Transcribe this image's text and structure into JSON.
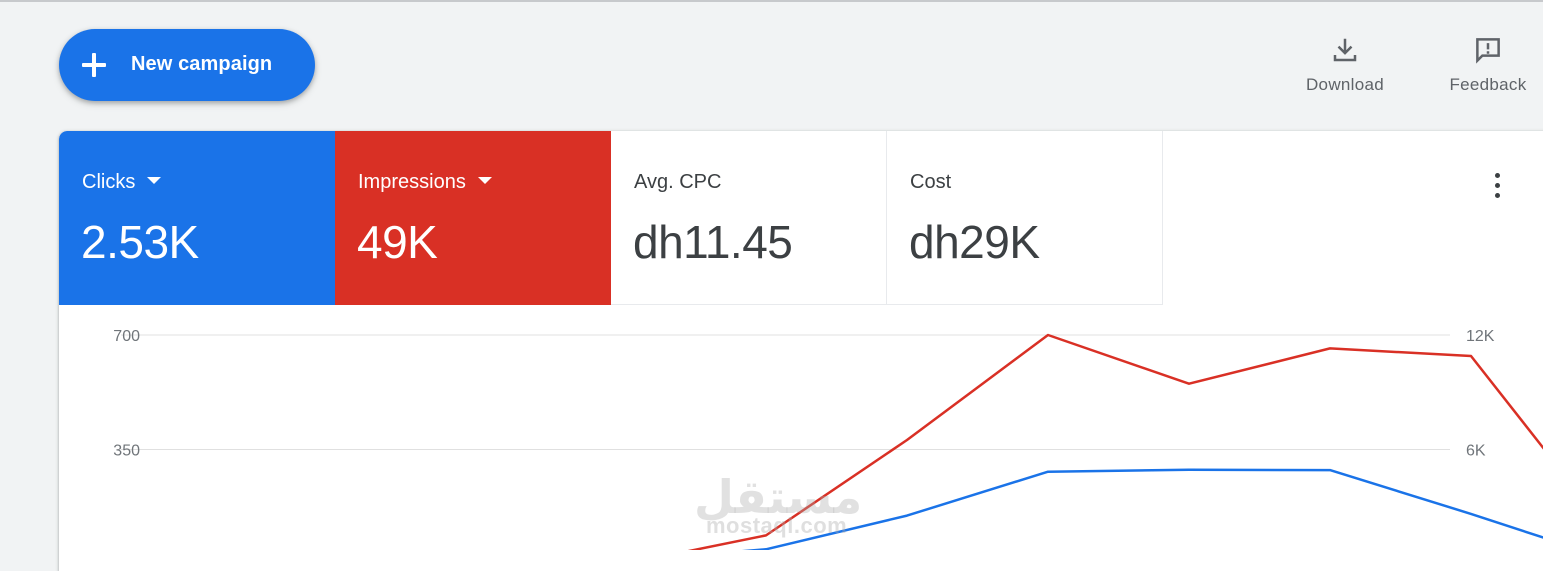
{
  "toolbar": {
    "new_campaign_label": "New campaign",
    "download_label": "Download",
    "feedback_label": "Feedback"
  },
  "scorecards": [
    {
      "label": "Clicks",
      "value": "2.53K",
      "color": "#1a73e8",
      "dropdown": true
    },
    {
      "label": "Impressions",
      "value": "49K",
      "color": "#d93025",
      "dropdown": true
    },
    {
      "label": "Avg. CPC",
      "value": "dh11.45",
      "color": "#ffffff",
      "dropdown": false
    },
    {
      "label": "Cost",
      "value": "dh29K",
      "color": "#ffffff",
      "dropdown": false
    }
  ],
  "icons": {
    "new_campaign": "plus-icon",
    "download": "download-icon",
    "feedback": "feedback-icon",
    "more": "more-vert-icon"
  },
  "watermark": {
    "arabic": "مستقل",
    "latin": "mostaql.com"
  },
  "chart_data": {
    "type": "line",
    "x_points": 9,
    "left_axis": {
      "ticks": [
        "700",
        "350"
      ],
      "ylim": [
        0,
        700
      ]
    },
    "right_axis": {
      "ticks": [
        "12K",
        "6K"
      ],
      "ylim": [
        0,
        12000
      ]
    },
    "grid": true,
    "series": [
      {
        "metric": "Clicks",
        "axis": "left",
        "color": "#1a73e8",
        "values": [
          null,
          null,
          null,
          null,
          10,
          45,
          148,
          282,
          288,
          287,
          153,
          12
        ]
      },
      {
        "metric": "Impressions",
        "axis": "right",
        "color": "#d93025",
        "values": [
          null,
          null,
          null,
          null,
          0,
          1500,
          6500,
          12000,
          9450,
          11300,
          10900,
          1500
        ]
      }
    ]
  }
}
